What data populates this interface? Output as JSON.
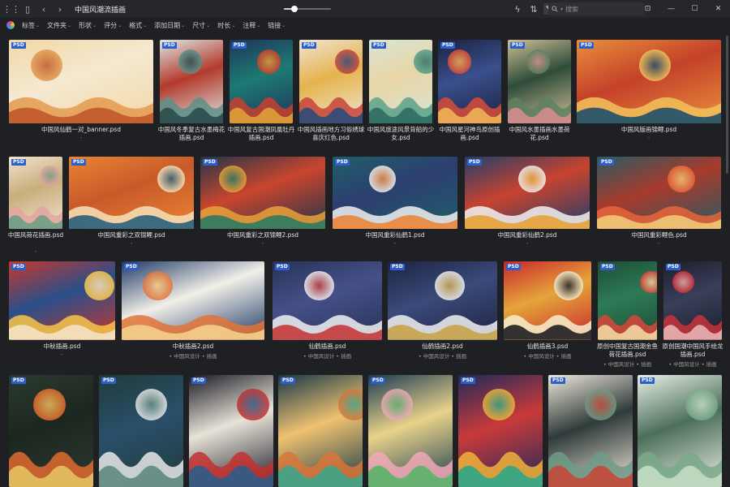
{
  "window": {
    "folder_title": "中国风潮流插画",
    "zoom_level_fraction": 0.22
  },
  "search": {
    "placeholder": "搜索"
  },
  "filters": [
    "标签",
    "文件夹",
    "形状",
    "评分",
    "格式",
    "添加日期",
    "尺寸",
    "时长",
    "注释",
    "链接"
  ],
  "tag_line": "• 中国风设计 • 插画",
  "colors": {
    "background": "#1f2023",
    "badge": "#2d5fc9",
    "tag_dot": "#5ab25a"
  },
  "items": [
    {
      "caption": "中国风仙鹤一对_banner.psd",
      "sub": "-",
      "colors": [
        "#f2d7a6",
        "#e39a4f",
        "#c0582b",
        "#f5e9d1"
      ]
    },
    {
      "caption": "中国风冬季复古水墨梅花插画.psd",
      "sub": "",
      "colors": [
        "#dfe7e4",
        "#5e8f8a",
        "#294c4d",
        "#b33a2c"
      ]
    },
    {
      "caption": "中国风复古国潮凤凰牡丹插画.psd",
      "sub": "",
      "colors": [
        "#20345c",
        "#c93f2f",
        "#e0a03a",
        "#1d7a72"
      ]
    },
    {
      "caption": "中国风插画地方习俗绣球喜庆红色.psd",
      "sub": "",
      "colors": [
        "#f0e5d4",
        "#c7433a",
        "#2b4b7a",
        "#e5b34d"
      ]
    },
    {
      "caption": "中国风旅途风景背船的少女.psd",
      "sub": "",
      "colors": [
        "#d9e5d2",
        "#5aa18b",
        "#2f6d64",
        "#e8d6a8"
      ]
    },
    {
      "caption": "中国风星河神鸟原创插画.psd",
      "sub": "",
      "colors": [
        "#1a2240",
        "#d74c3a",
        "#f0b257",
        "#3a4f8c"
      ]
    },
    {
      "caption": "中国风水墨插画水墨荷花.psd",
      "sub": "",
      "colors": [
        "#cdbf96",
        "#5f8060",
        "#d68d8d",
        "#2f4c3a"
      ]
    },
    {
      "caption": "中国风版画锦鲤.psd",
      "sub": "-",
      "colors": [
        "#e98f3b",
        "#f2c25a",
        "#1f4f6a",
        "#c4412a"
      ]
    },
    {
      "caption": "中国风荷花插画.psd",
      "sub": "-",
      "colors": [
        "#efe3cf",
        "#e3a4a0",
        "#6f9d84",
        "#c9ae7c"
      ]
    },
    {
      "caption": "中国风重彩之双锦鲤.psd",
      "sub": "-",
      "colors": [
        "#e98433",
        "#f7e1b8",
        "#2b5f7a",
        "#c85a2a"
      ]
    },
    {
      "caption": "中国风重彩之双锦鲤2.psd",
      "sub": "-",
      "colors": [
        "#24354a",
        "#e7a13a",
        "#2e7a5f",
        "#c9452e"
      ]
    },
    {
      "caption": "中国风重彩仙鹤1.psd",
      "sub": "-",
      "colors": [
        "#1f5e6a",
        "#f1f1f1",
        "#e9863a",
        "#2d3f6f"
      ]
    },
    {
      "caption": "中国风重彩仙鹤2.psd",
      "sub": "-",
      "colors": [
        "#233e6b",
        "#f2f2f2",
        "#e6a23a",
        "#c8432f"
      ]
    },
    {
      "caption": "中国风重彩鲤色.psd",
      "sub": "-",
      "colors": [
        "#2a5b63",
        "#e7643b",
        "#f0c978",
        "#a73a2c"
      ]
    },
    {
      "caption": "中秋插画.psd",
      "sub": "-",
      "colors": [
        "#c7372c",
        "#f7c64a",
        "#f4e2c4",
        "#2a4f8a"
      ]
    },
    {
      "caption": "中秋插画2.psd",
      "sub": "tags",
      "colors": [
        "#1e3a66",
        "#e2743a",
        "#f3d08a",
        "#f2efe8"
      ]
    },
    {
      "caption": "仙鹤插画.psd",
      "sub": "tags",
      "colors": [
        "#283355",
        "#f1f1f1",
        "#c43b3b",
        "#45508a"
      ]
    },
    {
      "caption": "仙鹤插画2.psd",
      "sub": "tags",
      "colors": [
        "#1e2440",
        "#f1f1f1",
        "#c9a34a",
        "#3a4a7a"
      ]
    },
    {
      "caption": "仙鹤插画3.psd",
      "sub": "tags",
      "colors": [
        "#c8262c",
        "#f7eecf",
        "#1f1f1f",
        "#e5a53a"
      ]
    },
    {
      "caption": "原创中国复古国潮金鱼荷花插画.psd",
      "sub": "tags",
      "colors": [
        "#1d4d35",
        "#d9453a",
        "#f0d6a0",
        "#2d7a56"
      ]
    },
    {
      "caption": "原创国潮中国风手绘龙插画.psd",
      "sub": "tags",
      "colors": [
        "#1b1e2a",
        "#c8323a",
        "#e8b2b2",
        "#3a3f5a"
      ]
    },
    {
      "caption": "",
      "sub": "",
      "colors": [
        "#2b3a2f",
        "#e26a2f",
        "#e3c260",
        "#1c2620"
      ]
    },
    {
      "caption": "",
      "sub": "",
      "colors": [
        "#1f3b3a",
        "#e8e8e8",
        "#5e8a7f",
        "#2a4f6a"
      ]
    },
    {
      "caption": "",
      "sub": "",
      "colors": [
        "#1a1a24",
        "#c3302f",
        "#2c5d8a",
        "#e8e3d8"
      ]
    },
    {
      "caption": "",
      "sub": "",
      "colors": [
        "#163848",
        "#d9763a",
        "#3ea58a",
        "#f0c270"
      ]
    },
    {
      "caption": "",
      "sub": "",
      "colors": [
        "#1c3a52",
        "#f1a8b8",
        "#5ab26a",
        "#e8d38a"
      ]
    },
    {
      "caption": "",
      "sub": "",
      "colors": [
        "#1e2a5a",
        "#f0b23a",
        "#2fa68a",
        "#c93a3a"
      ]
    },
    {
      "caption": "",
      "sub": "",
      "colors": [
        "#efe8dc",
        "#6e9a86",
        "#c4493a",
        "#2f3b3a"
      ]
    },
    {
      "caption": "",
      "sub": "",
      "colors": [
        "#e9efe6",
        "#7aa88a",
        "#c3dcc4",
        "#4c6f5a"
      ]
    }
  ]
}
